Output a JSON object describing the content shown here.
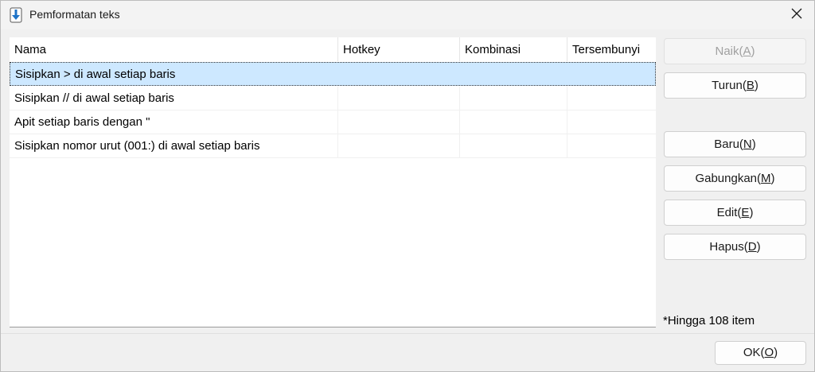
{
  "window": {
    "title": "Pemformatan teks"
  },
  "icons": {
    "app": "download-arrow-icon",
    "close": "close-icon"
  },
  "columns": [
    "Nama",
    "Hotkey",
    "Kombinasi",
    "Tersembunyi"
  ],
  "rows": [
    {
      "nama": "Sisipkan > di awal setiap baris",
      "hotkey": "",
      "kombinasi": "",
      "tersembunyi": "",
      "selected": true
    },
    {
      "nama": "Sisipkan // di awal setiap baris",
      "hotkey": "",
      "kombinasi": "",
      "tersembunyi": "",
      "selected": false
    },
    {
      "nama": "Apit setiap baris dengan \"",
      "hotkey": "",
      "kombinasi": "",
      "tersembunyi": "",
      "selected": false
    },
    {
      "nama": "Sisipkan nomor urut (001:) di awal setiap baris",
      "hotkey": "",
      "kombinasi": "",
      "tersembunyi": "",
      "selected": false
    }
  ],
  "buttons": {
    "naik": {
      "label": "Naik",
      "key": "A",
      "enabled": false
    },
    "turun": {
      "label": "Turun",
      "key": "B",
      "enabled": true
    },
    "baru": {
      "label": "Baru",
      "key": "N",
      "enabled": true
    },
    "gabungkan": {
      "label": "Gabungkan",
      "key": "M",
      "enabled": true
    },
    "edit": {
      "label": "Edit",
      "key": "E",
      "enabled": true
    },
    "hapus": {
      "label": "Hapus",
      "key": "D",
      "enabled": true
    },
    "ok": {
      "label": "OK",
      "key": "O",
      "enabled": true
    }
  },
  "note": "*Hingga 108 item",
  "colors": {
    "selection": "#cde8ff",
    "icon_blue": "#1e73c8"
  }
}
